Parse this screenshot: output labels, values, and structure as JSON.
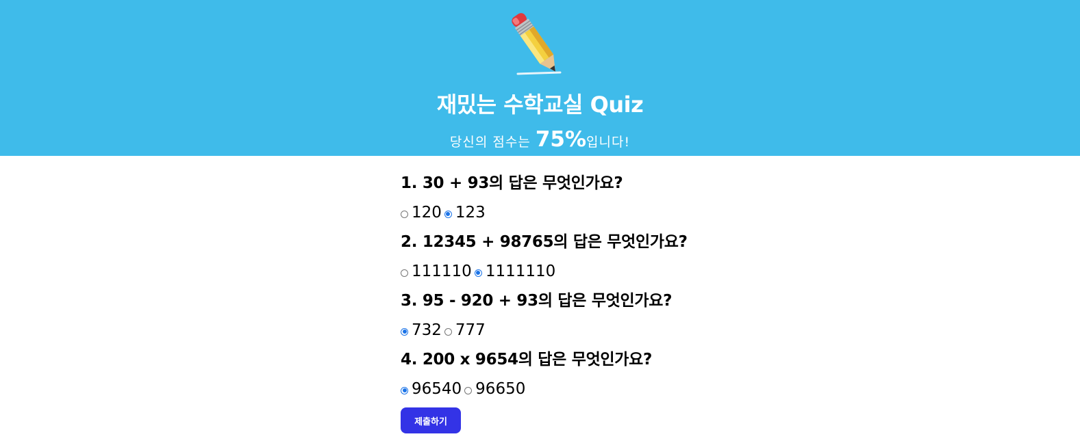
{
  "header": {
    "title": "재밌는 수학교실 Quiz",
    "score_prefix": "당신의 점수는 ",
    "score_value": "75%",
    "score_suffix": "입니다!"
  },
  "questions": [
    {
      "text": "1. 30 + 93의 답은 무엇인가요?",
      "options": [
        {
          "label": "120",
          "checked": false
        },
        {
          "label": "123",
          "checked": true
        }
      ]
    },
    {
      "text": "2. 12345 + 98765의 답은 무엇인가요?",
      "options": [
        {
          "label": "111110",
          "checked": false
        },
        {
          "label": "1111110",
          "checked": true
        }
      ]
    },
    {
      "text": "3. 95 - 920 + 93의 답은 무엇인가요?",
      "options": [
        {
          "label": "732",
          "checked": true
        },
        {
          "label": "777",
          "checked": false
        }
      ]
    },
    {
      "text": "4. 200 x 9654의 답은 무엇인가요?",
      "options": [
        {
          "label": "96540",
          "checked": true
        },
        {
          "label": "96650",
          "checked": false
        }
      ]
    }
  ],
  "submit_label": "제출하기",
  "colors": {
    "header_bg": "#3fbbea",
    "submit_bg": "#3333e6",
    "radio_accent": "#1a73e8"
  },
  "icons": {
    "logo": "pencil-icon"
  }
}
